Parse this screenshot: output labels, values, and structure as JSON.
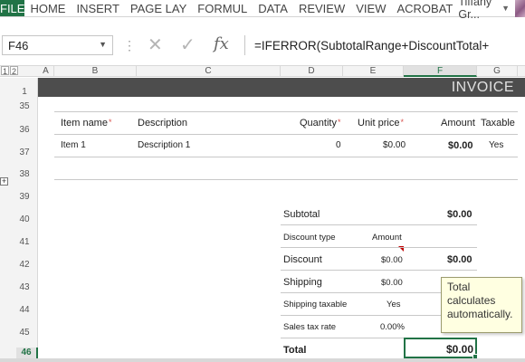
{
  "ribbon": {
    "file": "FILE",
    "tabs": [
      "HOME",
      "INSERT",
      "PAGE LAY",
      "FORMUL",
      "DATA",
      "REVIEW",
      "VIEW",
      "ACROBAT"
    ],
    "user": "Tiffany Gr..."
  },
  "formula_bar": {
    "name_box": "F46",
    "formula": "=IFERROR(SubtotalRange+DiscountTotal+",
    "cancel_icon": "close-icon",
    "enter_icon": "check-icon",
    "fx_label": "fx"
  },
  "columns": [
    "A",
    "B",
    "C",
    "D",
    "E",
    "F",
    "G"
  ],
  "group_levels": [
    "1",
    "2"
  ],
  "rows": [
    "1",
    "35",
    "36",
    "37",
    "38",
    "39",
    "40",
    "41",
    "42",
    "43",
    "44",
    "45",
    "46"
  ],
  "active": {
    "column": "F",
    "row": "46"
  },
  "invoice": {
    "title": "INVOICE",
    "headers": {
      "item_name": "Item name",
      "description": "Description",
      "quantity": "Quantity",
      "unit_price": "Unit price",
      "amount": "Amount",
      "taxable": "Taxable"
    },
    "required_mark": "*",
    "items": [
      {
        "item_name": "Item 1",
        "description": "Description 1",
        "quantity": "0",
        "unit_price": "$0.00",
        "amount": "$0.00",
        "taxable": "Yes"
      }
    ]
  },
  "totals": {
    "subtotal_label": "Subtotal",
    "subtotal_value": "$0.00",
    "discount_type_label": "Discount type",
    "discount_type_value": "Amount",
    "discount_label": "Discount",
    "discount_input": "$0.00",
    "discount_value": "$0.00",
    "shipping_label": "Shipping",
    "shipping_value": "$0.00",
    "shipping_taxable_label": "Shipping taxable",
    "shipping_taxable_value": "Yes",
    "sales_tax_label": "Sales tax rate",
    "sales_tax_value": "0.00%",
    "total_label": "Total",
    "total_value": "$0.00"
  },
  "tooltip": {
    "text": "Total\ncalculates\nautomatically."
  },
  "colors": {
    "excel_green": "#217346",
    "banner": "#4d4d4d",
    "tooltip_bg": "#ffffe1"
  }
}
